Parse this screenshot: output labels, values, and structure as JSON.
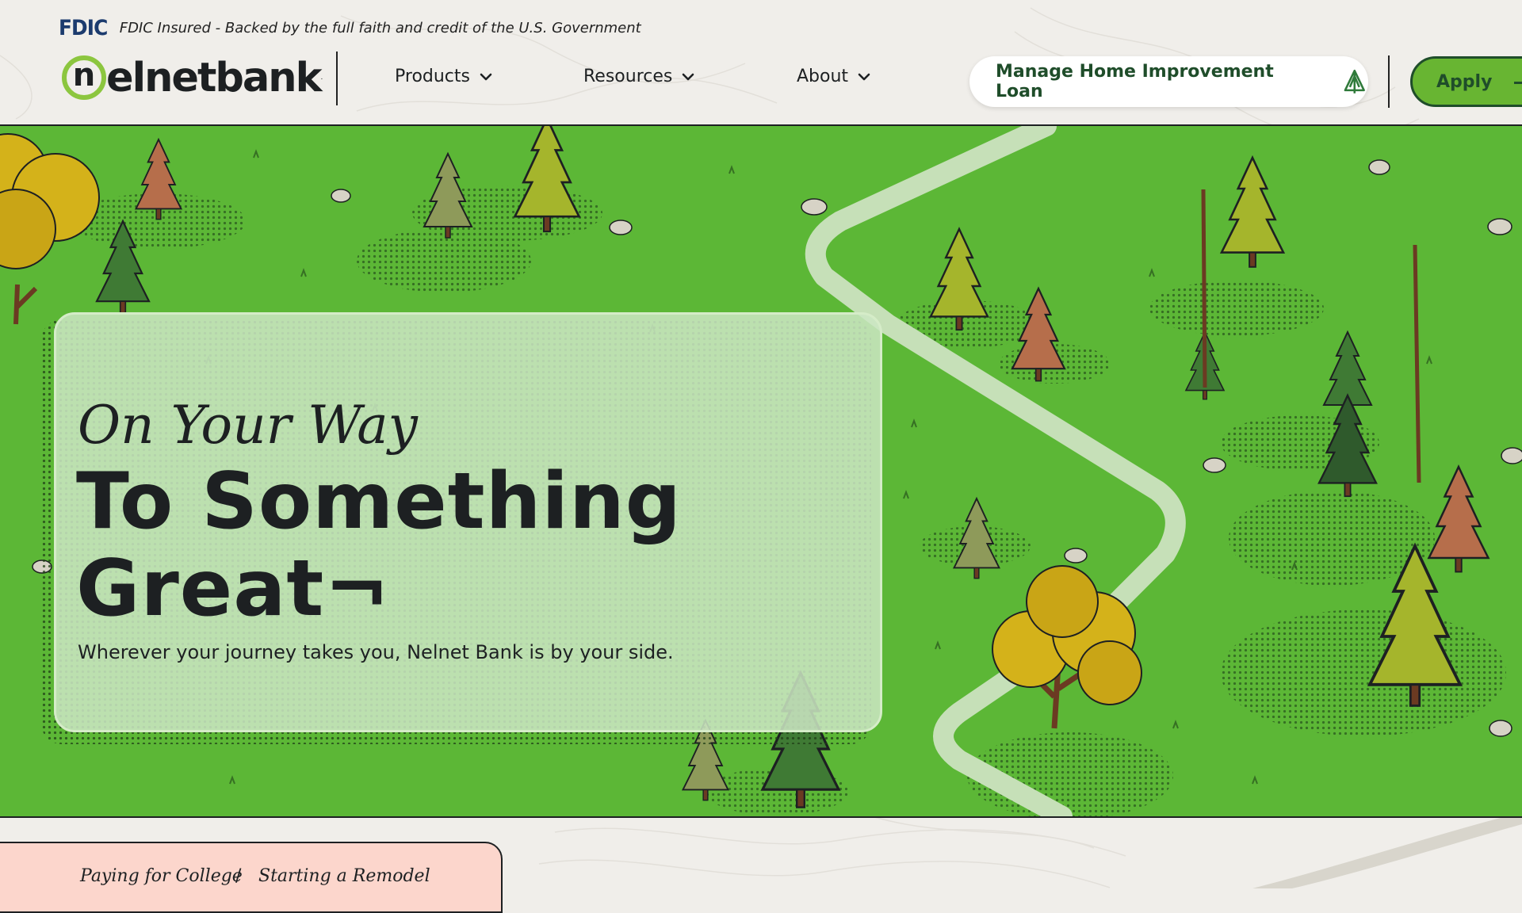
{
  "fdic": {
    "logo_text": "FDIC",
    "statement": "FDIC Insured - Backed by the full faith and credit of the U.S. Government"
  },
  "brand": {
    "logo_letter": "n",
    "logo_word": "elnetbank",
    "logo_mark": ".",
    "accent_color": "#8cc63f",
    "dark_green": "#1f4d2a"
  },
  "nav": {
    "items": [
      {
        "label": "Products",
        "icon": "chevron-down-icon"
      },
      {
        "label": "Resources",
        "icon": "chevron-down-icon"
      },
      {
        "label": "About",
        "icon": "chevron-down-icon"
      }
    ]
  },
  "header_actions": {
    "manage_label": "Manage Home Improvement Loan",
    "manage_icon": "tree-outline-icon",
    "apply_label": "Apply"
  },
  "hero": {
    "kicker": "On Your Way",
    "title": "To Something Great¬",
    "subtitle": "Wherever your journey takes you, Nelnet Bank is by your side."
  },
  "tabs": {
    "items": [
      "Paying for College",
      "Starting a Remodel"
    ],
    "separator": "/"
  }
}
